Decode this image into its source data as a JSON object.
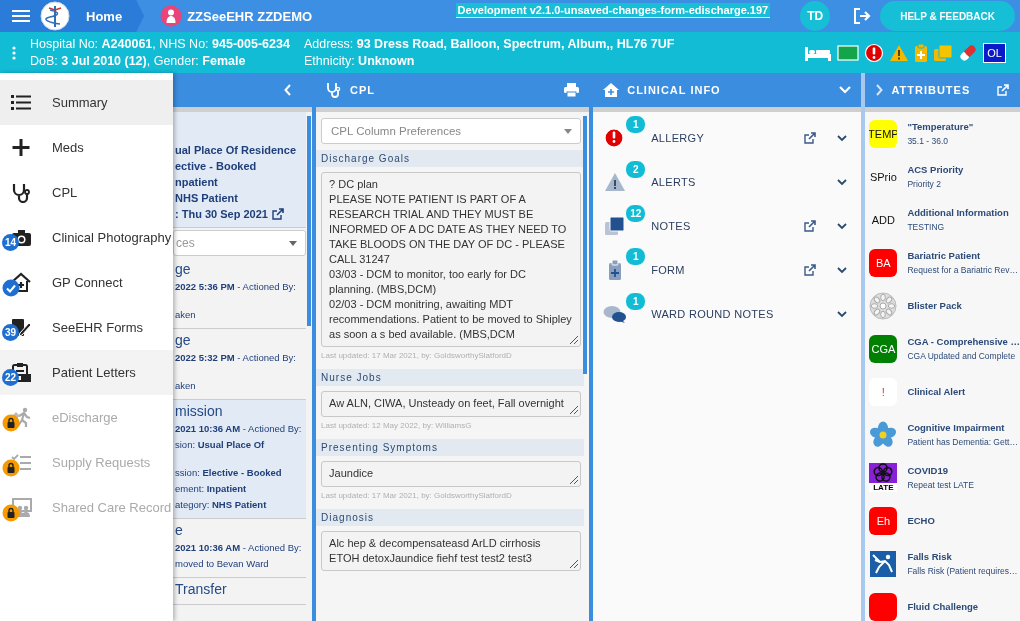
{
  "top_bar": {
    "home": "Home",
    "patient_name": "ZZSeeEHR ZZDEMO",
    "build": "Development v2.1.0-unsaved-changes-form-edischarge.197",
    "user_initials": "TD",
    "help_button": "HELP & FEEDBACK"
  },
  "patient_banner": {
    "line_1": "Hospital No: **A240061**, NHS No: **945-005-6234**",
    "line_2": "DoB: **3 Jul 2010 (12)**, Gender: **Female**",
    "address": "Address: **93 Dress Road, Balloon, Spectrum, Album,, HL76 7UF**",
    "ethnicity": "Ethnicity: **Unknown**",
    "badge": "OL"
  },
  "menu": {
    "items": [
      {
        "label": "Summary",
        "selected": true,
        "hovered": false,
        "disabled": false
      },
      {
        "label": "Meds",
        "selected": false,
        "hovered": false,
        "disabled": false
      },
      {
        "label": "CPL",
        "selected": false,
        "hovered": false,
        "disabled": false
      },
      {
        "label": "Clinical Photography",
        "selected": false,
        "hovered": false,
        "disabled": false,
        "badge": "14"
      },
      {
        "label": "GP Connect",
        "selected": false,
        "hovered": false,
        "disabled": false,
        "verified": true
      },
      {
        "label": "SeeEHR Forms",
        "selected": false,
        "hovered": false,
        "disabled": false,
        "badge": "39"
      },
      {
        "label": "Patient Letters",
        "selected": false,
        "hovered": true,
        "disabled": false,
        "badge": "22"
      },
      {
        "label": "eDischarge",
        "selected": false,
        "hovered": false,
        "disabled": true
      },
      {
        "label": "Supply Requests",
        "selected": false,
        "hovered": false,
        "disabled": true
      },
      {
        "label": "Shared Care Record",
        "selected": false,
        "hovered": false,
        "disabled": true
      }
    ]
  },
  "timeline_column": {
    "dropdown": "ces",
    "cards": [
      {
        "highlighted": true,
        "lines": [
          {
            "kind": "bold",
            "text": "ual Place Of Residence"
          },
          {
            "kind": "bold",
            "text": "ective - Booked"
          },
          {
            "kind": "bold",
            "text": "npatient"
          },
          {
            "kind": "bold",
            "text": "NHS Patient"
          },
          {
            "kind": "bold_link",
            "text": ": Thu 30 Sep 2021"
          }
        ]
      },
      {
        "highlighted": false,
        "lines": [
          {
            "kind": "title",
            "text": "ge"
          },
          {
            "kind": "text",
            "text": "**2022 5:36 PM** - Actioned By:"
          },
          {
            "kind": "text",
            "text": "aken",
            "spaced": true
          }
        ]
      },
      {
        "highlighted": false,
        "lines": [
          {
            "kind": "title",
            "text": "ge"
          },
          {
            "kind": "text",
            "text": "**2022 5:32 PM** - Actioned By:"
          },
          {
            "kind": "text",
            "text": "aken",
            "spaced": true
          }
        ]
      },
      {
        "highlighted": true,
        "lines": [
          {
            "kind": "title",
            "text": "mission"
          },
          {
            "kind": "text",
            "text": "**2021 10:36 AM** - Actioned By:"
          },
          {
            "kind": "text",
            "text": "sion: **Usual Place Of**"
          },
          {
            "kind": "text",
            "text": "ssion: **Elective - Booked**",
            "spaced": true
          },
          {
            "kind": "text",
            "text": "ement: **Inpatient**"
          },
          {
            "kind": "text",
            "text": "ategory: **NHS Patient**"
          }
        ]
      },
      {
        "highlighted": false,
        "lines": [
          {
            "kind": "title",
            "text": "e"
          },
          {
            "kind": "text",
            "text": "**2021 10:36 AM** - Actioned By:"
          },
          {
            "kind": "text",
            "text": "moved to Bevan Ward"
          }
        ]
      },
      {
        "highlighted": false,
        "lines": [
          {
            "kind": "title",
            "text": "Transfer"
          }
        ]
      }
    ]
  },
  "cpl": {
    "title": "CPL",
    "preferences_placeholder": "CPL Column Preferences",
    "sections": [
      {
        "title": "Discharge Goals",
        "value": "? DC plan\nPLEASE NOTE PATIENT IS PART OF A RESEARCH TRIAL AND THEY MUST BE INFORMED OF A DC DATE AS THEY NEED TO TAKE BLOODS ON THE DAY OF DC - PLEASE CALL 31247\n03/03 - DCM to monitor, too early for DC planning. (MBS,DCM)\n02/03 - DCM monitring, awaiting MDT recommendations. Patient to be moved to Shipley as soon a s bed available. (MBS,DCM",
        "updated": "Last updated: 17 Mar 2021, by: GoldsworthySlatfordD"
      },
      {
        "title": "Nurse Jobs",
        "value": "Aw ALN, CIWA, Unsteady on feet, Fall overnight",
        "updated": "Last updated: 12 May 2022, by: WilliamsG"
      },
      {
        "title": "Presenting Symptoms",
        "value": "Jaundice",
        "updated": "Last updated: 17 Mar 2021, by: GoldsworthySlatfordD"
      },
      {
        "title": "Diagnosis",
        "value": "Alc hep & decompensateasd ArLD cirrhosis\nETOH detoxJaundice fiehf test test2 test3"
      }
    ]
  },
  "clinical_info": {
    "title": "CLINICAL INFO",
    "items": [
      {
        "label": "ALLERGY",
        "count": "1",
        "external_link": true
      },
      {
        "label": "ALERTS",
        "count": "2",
        "external_link": false
      },
      {
        "label": "NOTES",
        "count": "12",
        "external_link": true
      },
      {
        "label": "FORM",
        "count": "1",
        "external_link": true
      },
      {
        "label": "WARD ROUND NOTES",
        "count": "1",
        "external_link": false
      }
    ]
  },
  "attributes": {
    "title": "ATTRIBUTES",
    "items": [
      {
        "kind": "tile",
        "tile_text": "TEMP",
        "color": "#ffff00",
        "title": "\"Temperature\"",
        "subtitle": "35.1 - 36.0"
      },
      {
        "kind": "tile",
        "tile_text": "SPrio",
        "color": "#f7f7f7",
        "title": "ACS Priority",
        "subtitle": "Priority 2"
      },
      {
        "kind": "tile",
        "tile_text": "ADD",
        "color": "#f7f7f7",
        "title": "Additional Information",
        "subtitle": "TESTING"
      },
      {
        "kind": "tile",
        "tile_text": "BA",
        "color": "#ff0000",
        "title": "Bariatric Patient",
        "subtitle": "Request for a Bariatric Rev…"
      },
      {
        "kind": "blister",
        "title": "Blister Pack"
      },
      {
        "kind": "tile",
        "tile_text": "CGA",
        "color": "#008000",
        "title": "CGA - Comprehensive …",
        "subtitle": "CGA Updated and Complete"
      },
      {
        "kind": "tile",
        "tile_text": "!",
        "color": "#ffffff",
        "title": "Clinical Alert"
      },
      {
        "kind": "flower",
        "title": "Cognitive Impairment",
        "subtitle": "Patient has Dementia: Gett…"
      },
      {
        "kind": "covid",
        "tile_text": "LATE",
        "title": "COVID19",
        "subtitle": "Repeat test LATE"
      },
      {
        "kind": "tile",
        "tile_text": "Eh",
        "color": "#ff0000",
        "title": "ECHO"
      },
      {
        "kind": "falls",
        "title": "Falls Risk",
        "subtitle": "Falls Risk (Patient requires…"
      },
      {
        "kind": "tile",
        "color": "#ff0000",
        "title": "Fluid Challenge"
      }
    ]
  }
}
